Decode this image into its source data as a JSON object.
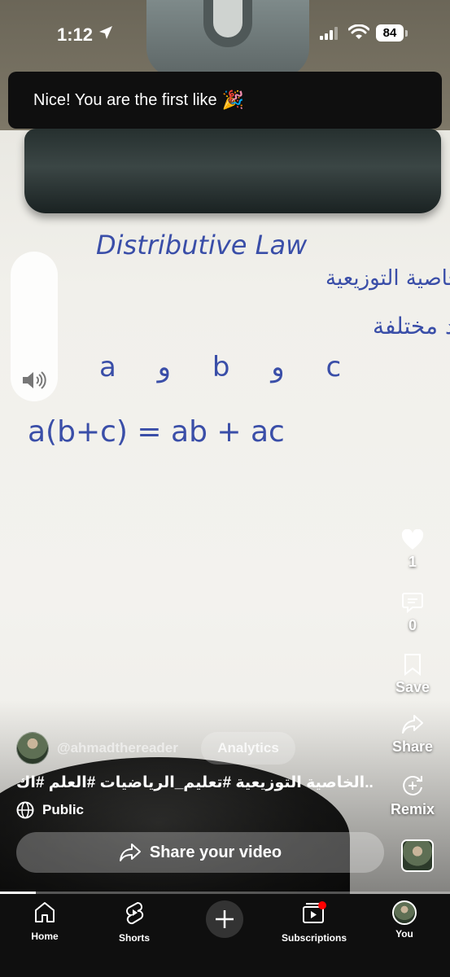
{
  "status_bar": {
    "time": "1:12",
    "battery": "84"
  },
  "toast": {
    "text": "Nice! You are the first like",
    "emoji": "🎉"
  },
  "video": {
    "board_text": {
      "line1": "Distributive Law",
      "line2": "الخاصية التوزيعية",
      "line3": "لدينا ثلاثة اعداد مختلفة",
      "line4": "a و b و c",
      "equation": "a(b+c) = ab + ac"
    },
    "progress_fraction": 0.08
  },
  "actions": {
    "like_count": "1",
    "comment_count": "0",
    "save_label": "Save",
    "share_label": "Share",
    "remix_label": "Remix"
  },
  "info": {
    "channel": "@ahmadthereader",
    "analytics_label": "Analytics",
    "title": "الخاصية التوزيعية #تعليم_الرياضيات #العلم #اك..",
    "visibility": "Public",
    "share_video_label": "Share your video"
  },
  "nav": {
    "home": "Home",
    "shorts": "Shorts",
    "subscriptions": "Subscriptions",
    "you": "You"
  },
  "colors": {
    "ink": "#3a4ea8",
    "nav_bg": "#0f0f0f",
    "badge": "#ff0000"
  }
}
